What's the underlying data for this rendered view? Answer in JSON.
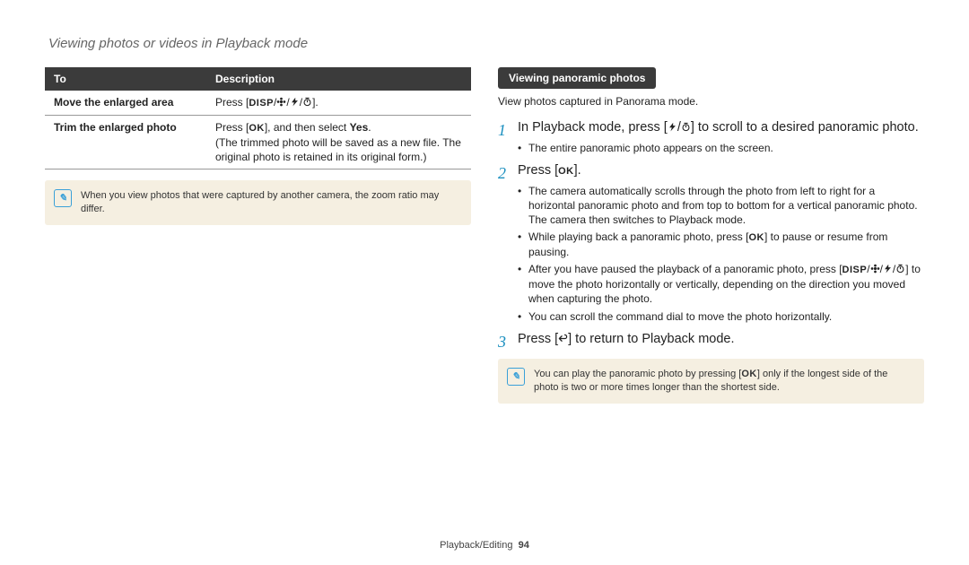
{
  "section_title": "Viewing photos or videos in Playback mode",
  "table": {
    "head_to": "To",
    "head_desc": "Description",
    "row1_label": "Move the enlarged area",
    "row1_desc_pre": "Press [",
    "row1_desc_post": "].",
    "row2_label": "Trim the enlarged photo",
    "row2_desc_line1_pre": "Press [",
    "row2_desc_line1_mid": "], and then select ",
    "row2_desc_line1_yes": "Yes",
    "row2_desc_line1_post": ".",
    "row2_desc_line2": "(The trimmed photo will be saved as a new file. The original photo is retained in its original form.)"
  },
  "left_note": "When you view photos that were captured by another camera, the zoom ratio may differ.",
  "right": {
    "pill": "Viewing panoramic photos",
    "intro": "View photos captured in Panorama mode.",
    "step1_pre": "In Playback mode, press [",
    "step1_post": "] to scroll to a desired panoramic photo.",
    "step1_sub1": "The entire panoramic photo appears on the screen.",
    "step2_pre": "Press [",
    "step2_post": "].",
    "step2_sub1": "The camera automatically scrolls through the photo from left to right for a horizontal panoramic photo and from top to bottom for a vertical panoramic photo. The camera then switches to Playback mode.",
    "step2_sub2_pre": "While playing back a panoramic photo, press [",
    "step2_sub2_post": "] to pause or resume from pausing.",
    "step2_sub3_pre": "After you have paused the playback of a panoramic photo, press [",
    "step2_sub3_post": "] to move the photo horizontally or vertically, depending on the direction you moved when capturing the photo.",
    "step2_sub4": "You can scroll the command dial to move the photo horizontally.",
    "step3_pre": "Press [",
    "step3_post": "] to return to Playback mode.",
    "note_pre": "You can play the panoramic photo by pressing [",
    "note_post": "] only if the longest side of the photo is two or more times longer than the shortest side."
  },
  "footer_section": "Playback/Editing",
  "footer_page": "94",
  "glyph": {
    "disp": "DISP",
    "ok": "OK"
  }
}
